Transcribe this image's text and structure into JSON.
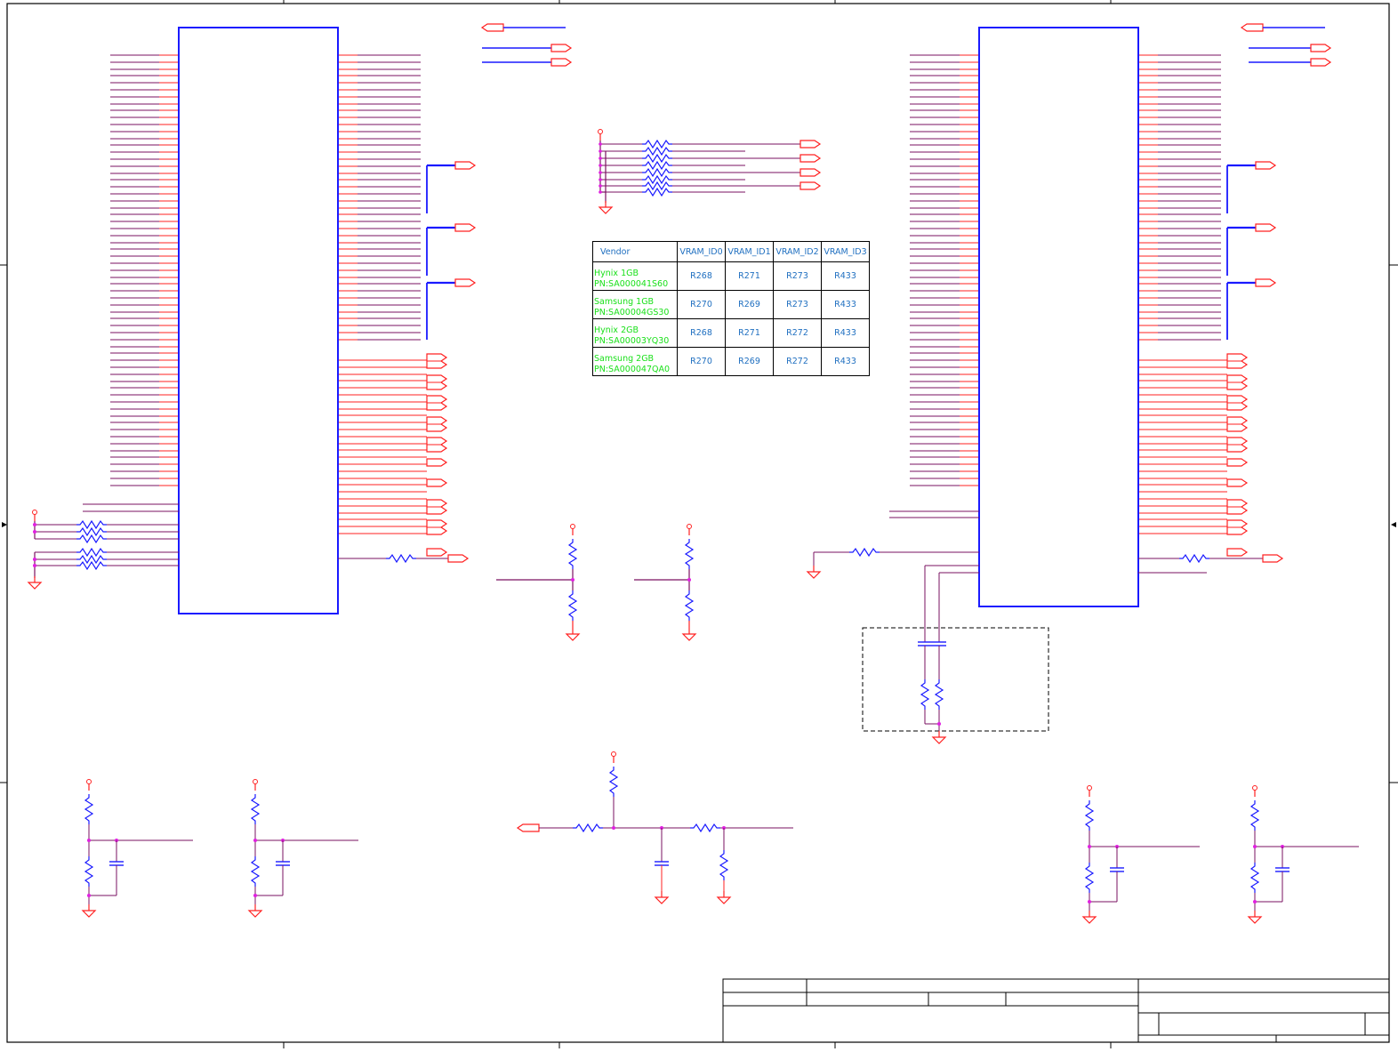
{
  "vram_table": {
    "headers": [
      "Vendor",
      "VRAM_ID0",
      "VRAM_ID1",
      "VRAM_ID2",
      "VRAM_ID3"
    ],
    "rows": [
      {
        "vendor": "Hynix   1GB",
        "pn": "PN:SA000041S60",
        "ids": [
          "R268",
          "R271",
          "R273",
          "R433"
        ]
      },
      {
        "vendor": "Samsung   1GB",
        "pn": "PN:SA00004GS30",
        "ids": [
          "R270",
          "R269",
          "R273",
          "R433"
        ]
      },
      {
        "vendor": "Hynix 2GB",
        "pn": "PN:SA00003YQ30",
        "ids": [
          "R268",
          "R271",
          "R272",
          "R433"
        ]
      },
      {
        "vendor": "Samsung 2GB",
        "pn": "PN:SA000047QA0",
        "ids": [
          "R270",
          "R269",
          "R272",
          "R433"
        ]
      }
    ]
  },
  "colors": {
    "ic_body": "#1a1aff",
    "pin_wire": "#ff2020",
    "net_wire": "#7a1060",
    "resistor": "#1a1aff",
    "junction": "#e020e0",
    "vendor_text": "#19e019",
    "id_text": "#1f6fc0",
    "frame": "#000000"
  },
  "icons": [
    "resistor-symbol",
    "capacitor-symbol",
    "ground-symbol",
    "power-pin-symbol",
    "offpage-connector-symbol"
  ]
}
